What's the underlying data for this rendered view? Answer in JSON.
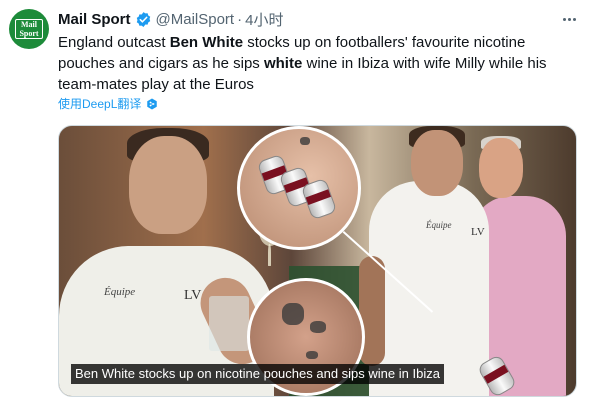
{
  "author": {
    "name": "Mail Sport",
    "handle": "@MailSport",
    "time": "4小时",
    "avatar_text_top": "Mail",
    "avatar_text_bottom": "Sport",
    "brand_color": "#1d8b3a"
  },
  "tweet": {
    "segments": [
      {
        "text": "England outcast ",
        "bold": false
      },
      {
        "text": "Ben White",
        "bold": true
      },
      {
        "text": " stocks up on footballers' favourite nicotine pouches and cigars as he sips ",
        "bold": false
      },
      {
        "text": "white",
        "bold": true
      },
      {
        "text": " wine in Ibiza with wife Milly while his team-mates play at the Euros",
        "bold": false
      }
    ],
    "translate_label": "使用DeepL翻译"
  },
  "media": {
    "caption": "Ben White stocks up on nicotine pouches and sips wine in Ibiza",
    "shirt_brand_text": "Équipe",
    "shirt_logo_text": "LV"
  },
  "icons": {
    "verified": "verified-badge-icon",
    "more": "more-options-icon",
    "deepl": "deepl-icon"
  },
  "colors": {
    "link": "#1d9bf0",
    "muted": "#536471",
    "text": "#0f1419"
  }
}
